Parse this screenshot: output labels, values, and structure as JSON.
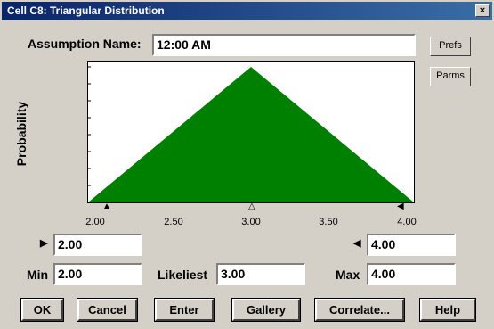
{
  "window": {
    "title": "Cell C8: Triangular Distribution",
    "close_glyph": "×"
  },
  "assumption": {
    "label": "Assumption Name:",
    "value": "12:00 AM"
  },
  "side_buttons": {
    "prefs": "Prefs",
    "parms": "Parms"
  },
  "chart": {
    "ylabel": "Probability",
    "ticks": [
      "2.00",
      "2.50",
      "3.00",
      "3.50",
      "4.00"
    ]
  },
  "chart_data": {
    "type": "area",
    "x": [
      2.0,
      3.0,
      4.0
    ],
    "y": [
      0,
      1,
      0
    ],
    "xlim": [
      2.0,
      4.0
    ],
    "ylabel": "Probability",
    "fill_color": "#008000"
  },
  "bounds": {
    "left_arrow": "▶",
    "left_value": "2.00",
    "right_arrow": "◀",
    "right_value": "4.00"
  },
  "params": {
    "min_label": "Min",
    "min_value": "2.00",
    "likeliest_label": "Likeliest",
    "likeliest_value": "3.00",
    "max_label": "Max",
    "max_value": "4.00"
  },
  "buttons": {
    "ok": "OK",
    "cancel": "Cancel",
    "enter": "Enter",
    "gallery": "Gallery",
    "correlate": "Correlate...",
    "help": "Help"
  },
  "colors": {
    "title_bar": "#0a246a",
    "dialog": "#d4d0c8",
    "distribution": "#008000"
  }
}
